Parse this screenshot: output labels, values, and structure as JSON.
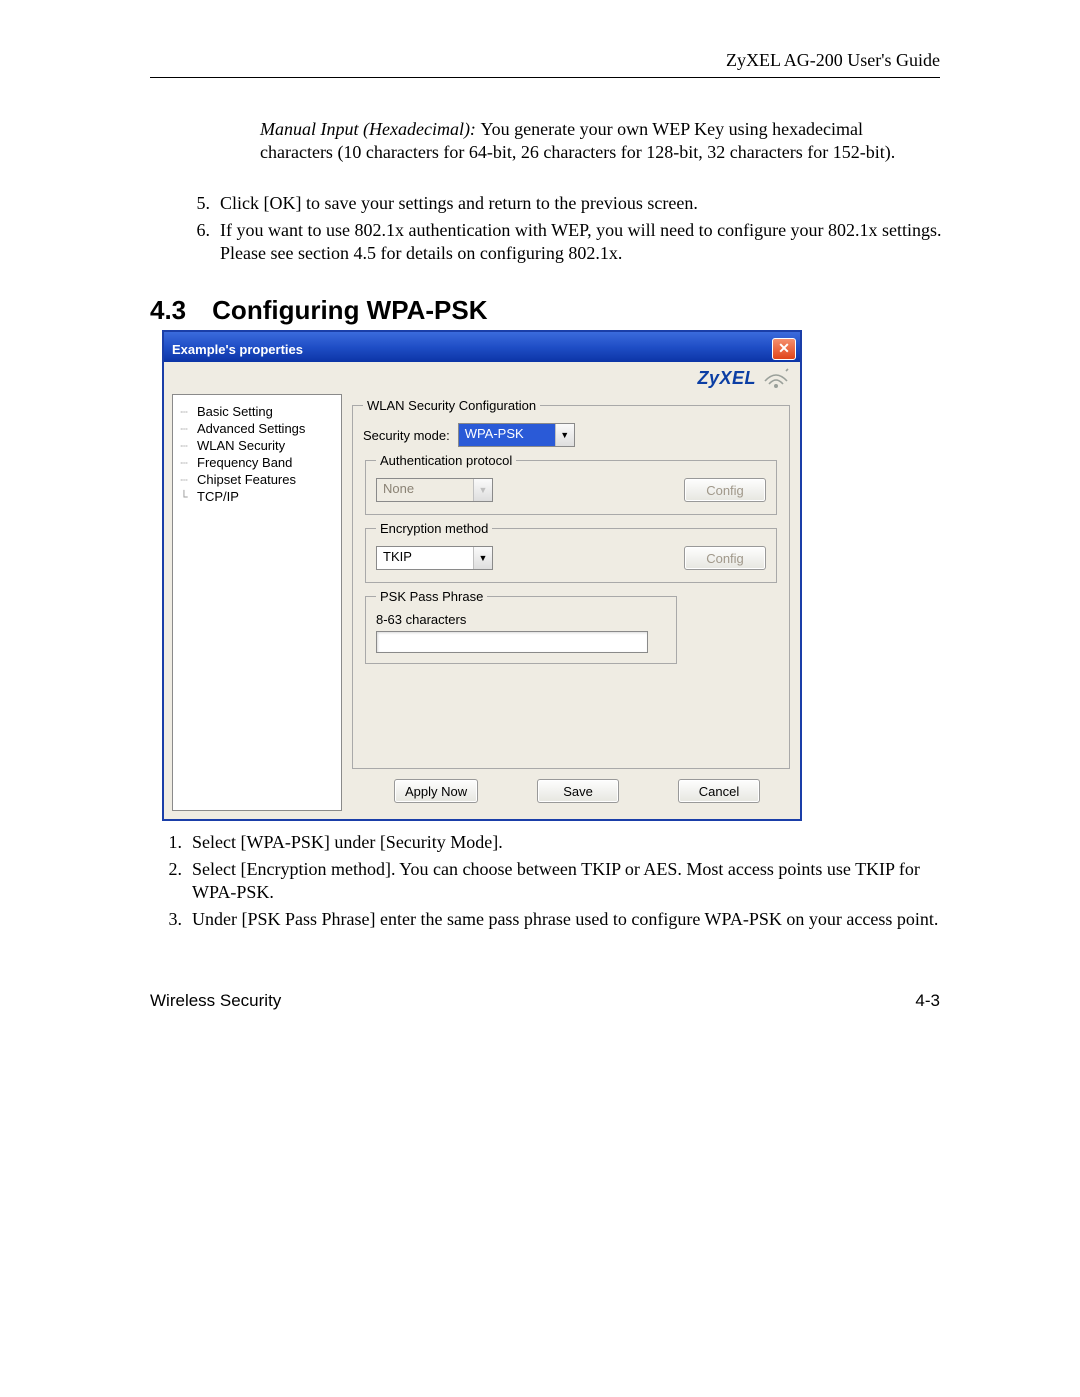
{
  "header": "ZyXEL AG-200 User's Guide",
  "intro_lead": "Manual Input (Hexadecimal): ",
  "intro_body": "You generate your own WEP Key using hexadecimal characters (10 characters for 64-bit, 26 characters for 128-bit, 32 characters for 152-bit).",
  "list_top": [
    {
      "n": "5.",
      "t": "Click [OK] to save your settings and return to the previous screen."
    },
    {
      "n": "6.",
      "t": "If you want to use 802.1x authentication with WEP, you will need to configure your 802.1x settings.  Please see section 4.5 for details on configuring 802.1x."
    }
  ],
  "section_num": "4.3",
  "section_title": "Configuring WPA-PSK",
  "dialog": {
    "title": "Example's properties",
    "brand": "ZyXEL",
    "tree": [
      "Basic Setting",
      "Advanced Settings",
      "WLAN Security",
      "Frequency Band",
      "Chipset Features",
      "TCP/IP"
    ],
    "fs_main": "WLAN Security Configuration",
    "secmode_label": "Security mode:",
    "secmode_value": "WPA-PSK",
    "fs_auth": "Authentication protocol",
    "auth_value": "None",
    "fs_enc": "Encryption method",
    "enc_value": "TKIP",
    "fs_psk": "PSK Pass Phrase",
    "psk_hint": "8-63 characters",
    "btn_config": "Config",
    "btn_apply": "Apply Now",
    "btn_save": "Save",
    "btn_cancel": "Cancel"
  },
  "list_bottom": [
    {
      "n": "1.",
      "t": "Select [WPA-PSK] under [Security Mode]."
    },
    {
      "n": "2.",
      "t": "Select [Encryption method].  You can choose between TKIP or AES.  Most access points use TKIP for WPA-PSK."
    },
    {
      "n": "3.",
      "t": "Under [PSK Pass Phrase] enter the same pass phrase used to configure WPA-PSK on your access point."
    }
  ],
  "foot_left": "Wireless Security",
  "foot_right": "4-3"
}
